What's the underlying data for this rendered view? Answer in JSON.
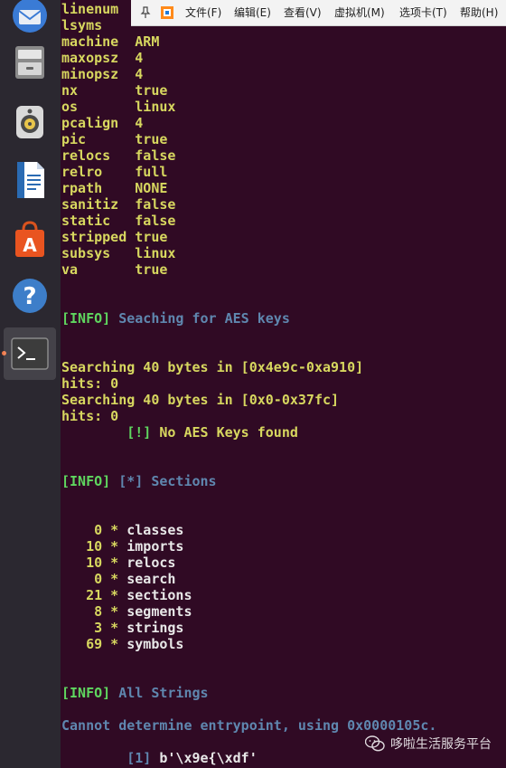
{
  "launcher": {
    "items": [
      {
        "name": "thunderbird-icon"
      },
      {
        "name": "files-icon"
      },
      {
        "name": "rhythmbox-icon"
      },
      {
        "name": "writer-icon"
      },
      {
        "name": "software-center-icon"
      },
      {
        "name": "help-icon"
      },
      {
        "name": "terminal-icon"
      }
    ]
  },
  "vm_toolbar": {
    "menus": [
      "文件(F)",
      "编辑(E)",
      "查看(V)",
      "虚拟机(M)",
      "选项卡(T)",
      "帮助(H)"
    ]
  },
  "terminal": {
    "lines": [
      {
        "segments": [
          {
            "text": "linenum",
            "color": "yellow"
          }
        ]
      },
      {
        "segments": [
          {
            "text": "lsyms",
            "color": "yellow"
          }
        ]
      },
      {
        "segments": [
          {
            "text": "machine  ARM",
            "color": "yellow"
          }
        ]
      },
      {
        "segments": [
          {
            "text": "maxopsz  4",
            "color": "yellow"
          }
        ]
      },
      {
        "segments": [
          {
            "text": "minopsz  4",
            "color": "yellow"
          }
        ]
      },
      {
        "segments": [
          {
            "text": "nx       true",
            "color": "yellow"
          }
        ]
      },
      {
        "segments": [
          {
            "text": "os       linux",
            "color": "yellow"
          }
        ]
      },
      {
        "segments": [
          {
            "text": "pcalign  4",
            "color": "yellow"
          }
        ]
      },
      {
        "segments": [
          {
            "text": "pic      true",
            "color": "yellow"
          }
        ]
      },
      {
        "segments": [
          {
            "text": "relocs   false",
            "color": "yellow"
          }
        ]
      },
      {
        "segments": [
          {
            "text": "relro    full",
            "color": "yellow"
          }
        ]
      },
      {
        "segments": [
          {
            "text": "rpath    NONE",
            "color": "yellow"
          }
        ]
      },
      {
        "segments": [
          {
            "text": "sanitiz  false",
            "color": "yellow"
          }
        ]
      },
      {
        "segments": [
          {
            "text": "static   false",
            "color": "yellow"
          }
        ]
      },
      {
        "segments": [
          {
            "text": "stripped true",
            "color": "yellow"
          }
        ]
      },
      {
        "segments": [
          {
            "text": "subsys   linux",
            "color": "yellow"
          }
        ]
      },
      {
        "segments": [
          {
            "text": "va       true",
            "color": "yellow"
          }
        ]
      },
      {
        "segments": []
      },
      {
        "segments": []
      },
      {
        "segments": [
          {
            "text": "[INFO]",
            "color": "green"
          },
          {
            "text": " Seaching for AES keys",
            "color": "cyan"
          }
        ]
      },
      {
        "segments": []
      },
      {
        "segments": []
      },
      {
        "segments": [
          {
            "text": "Searching 40 bytes in [0x4e9c-0xa910]",
            "color": "yellow"
          }
        ]
      },
      {
        "segments": [
          {
            "text": "hits: 0",
            "color": "yellow"
          }
        ]
      },
      {
        "segments": [
          {
            "text": "Searching 40 bytes in [0x0-0x37fc]",
            "color": "yellow"
          }
        ]
      },
      {
        "segments": [
          {
            "text": "hits: 0",
            "color": "yellow"
          }
        ]
      },
      {
        "segments": [
          {
            "text": "        [!]",
            "color": "green"
          },
          {
            "text": " No AES Keys found",
            "color": "yellow"
          }
        ]
      },
      {
        "segments": []
      },
      {
        "segments": []
      },
      {
        "segments": [
          {
            "text": "[INFO]",
            "color": "green"
          },
          {
            "text": " [*] Sections",
            "color": "cyan"
          }
        ]
      },
      {
        "segments": []
      },
      {
        "segments": []
      },
      {
        "segments": [
          {
            "text": "    0 * ",
            "color": "yellow"
          },
          {
            "text": "classes",
            "color": "white"
          }
        ]
      },
      {
        "segments": [
          {
            "text": "   10 * ",
            "color": "yellow"
          },
          {
            "text": "imports",
            "color": "white"
          }
        ]
      },
      {
        "segments": [
          {
            "text": "   10 * ",
            "color": "yellow"
          },
          {
            "text": "relocs",
            "color": "white"
          }
        ]
      },
      {
        "segments": [
          {
            "text": "    0 * ",
            "color": "yellow"
          },
          {
            "text": "search",
            "color": "white"
          }
        ]
      },
      {
        "segments": [
          {
            "text": "   21 * ",
            "color": "yellow"
          },
          {
            "text": "sections",
            "color": "white"
          }
        ]
      },
      {
        "segments": [
          {
            "text": "    8 * ",
            "color": "yellow"
          },
          {
            "text": "segments",
            "color": "white"
          }
        ]
      },
      {
        "segments": [
          {
            "text": "    3 * ",
            "color": "yellow"
          },
          {
            "text": "strings",
            "color": "white"
          }
        ]
      },
      {
        "segments": [
          {
            "text": "   69 * ",
            "color": "yellow"
          },
          {
            "text": "symbols",
            "color": "white"
          }
        ]
      },
      {
        "segments": []
      },
      {
        "segments": []
      },
      {
        "segments": [
          {
            "text": "[INFO]",
            "color": "green"
          },
          {
            "text": " All Strings",
            "color": "cyan"
          }
        ]
      },
      {
        "segments": []
      },
      {
        "segments": [
          {
            "text": "Cannot determine entrypoint, using 0x0000105c.",
            "color": "cyan"
          }
        ]
      },
      {
        "segments": []
      },
      {
        "segments": [
          {
            "text": "        [1]",
            "color": "cyan"
          },
          {
            "text": " b'\\x9e{\\xdf'",
            "color": "white"
          }
        ]
      }
    ]
  },
  "watermark": {
    "text": "哆啦生活服务平台"
  },
  "colors": {
    "terminal_bg": "#300a24",
    "launcher_bg": "#2b2830",
    "yellow": "#d7d75f",
    "green": "#5fd75f",
    "cyan": "#5f87af",
    "white": "#e8e8e8"
  }
}
